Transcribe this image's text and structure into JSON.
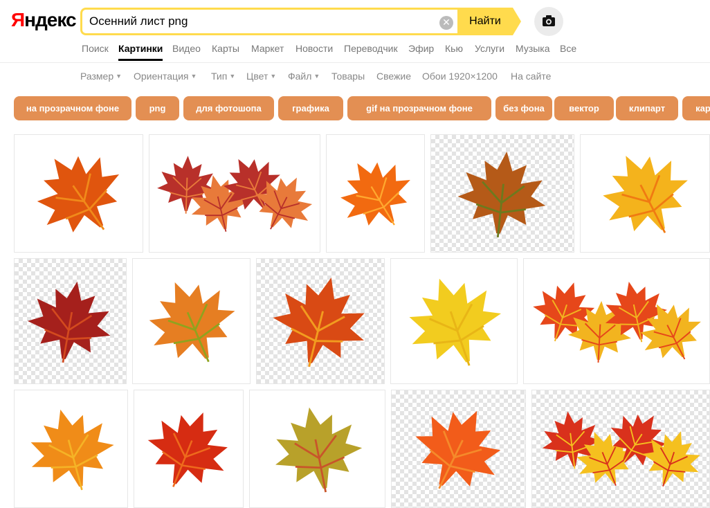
{
  "header": {
    "logo": {
      "first": "Я",
      "rest": "ндекс"
    },
    "search": {
      "value": "Осенний лист png",
      "clear_icon": "close-icon",
      "button_label": "Найти"
    },
    "camera_icon": "camera-icon"
  },
  "nav": {
    "items": [
      "Поиск",
      "Картинки",
      "Видео",
      "Карты",
      "Маркет",
      "Новости",
      "Переводчик",
      "Эфир",
      "Кью",
      "Услуги",
      "Музыка",
      "Все"
    ],
    "active": "Картинки"
  },
  "filters": {
    "items": [
      "Размер",
      "Ориентация",
      "Тип",
      "Цвет",
      "Файл",
      "Товары",
      "Свежие",
      "Обои 1920×1200",
      "На сайте"
    ],
    "dropdown_count": 5
  },
  "chips": [
    "на прозрачном фоне",
    "png",
    "для фотошопа",
    "графика",
    "gif на прозрачном фоне",
    "без фона",
    "вектор",
    "клипарт",
    "кар"
  ],
  "colors": {
    "accent": "#ffdb4d",
    "chip": "#e38f53",
    "logo_red": "#ff0000"
  },
  "images": [
    {
      "row": 1,
      "palette": [
        "#e0550e",
        "#f08a1a"
      ],
      "background": "white"
    },
    {
      "row": 1,
      "palette": [
        "#b8302a",
        "#e87a3a"
      ],
      "background": "white"
    },
    {
      "row": 1,
      "palette": [
        "#f26a10",
        "#ffa82e"
      ],
      "background": "white"
    },
    {
      "row": 1,
      "palette": [
        "#b55a18",
        "#6c7a1e"
      ],
      "background": "transparent"
    },
    {
      "row": 1,
      "palette": [
        "#f4b31c",
        "#f07a12"
      ],
      "background": "white"
    },
    {
      "row": 2,
      "palette": [
        "#a5201c",
        "#d34a1e"
      ],
      "background": "transparent"
    },
    {
      "row": 2,
      "palette": [
        "#e67e22",
        "#8fa31e"
      ],
      "background": "white"
    },
    {
      "row": 2,
      "palette": [
        "#d94a14",
        "#f29c1f"
      ],
      "background": "transparent"
    },
    {
      "row": 2,
      "palette": [
        "#f2cc1f",
        "#e8b516"
      ],
      "background": "white"
    },
    {
      "row": 2,
      "palette": [
        "#e6471a",
        "#f2b41f"
      ],
      "background": "white"
    },
    {
      "row": 3,
      "palette": [
        "#f08c18",
        "#f5b326"
      ],
      "background": "white"
    },
    {
      "row": 3,
      "palette": [
        "#d62c12",
        "#ee6a1c"
      ],
      "background": "white"
    },
    {
      "row": 3,
      "palette": [
        "#b8a12a",
        "#c8552a"
      ],
      "background": "white"
    },
    {
      "row": 3,
      "palette": [
        "#f25c1a",
        "#f58a2a"
      ],
      "background": "transparent"
    },
    {
      "row": 3,
      "palette": [
        "#d9311c",
        "#f5c01f"
      ],
      "background": "transparent"
    }
  ]
}
